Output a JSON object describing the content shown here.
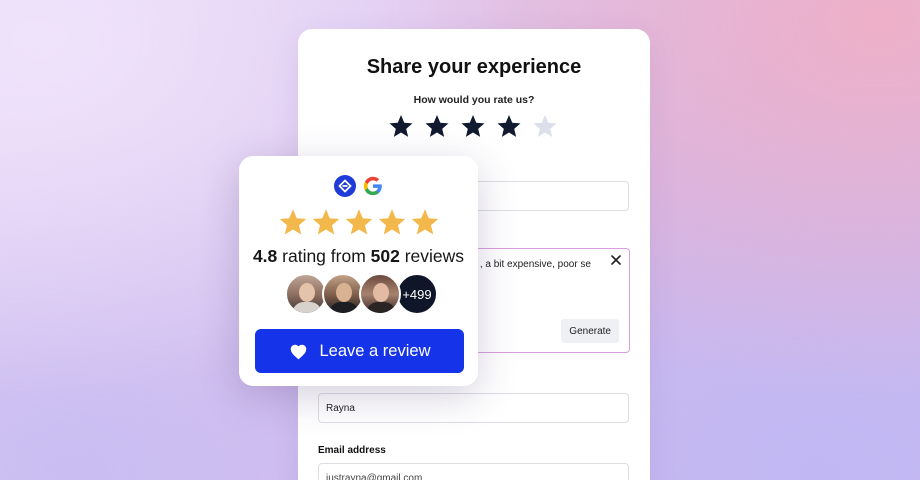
{
  "form": {
    "title": "Share your experience",
    "rate_question": "How would you rate us?",
    "rating": 4,
    "max_rating": 5,
    "star_color": "#121a30",
    "star_empty_color": "#dde0ea",
    "review_text": ", a bit expensive, poor se",
    "generate_label": "Generate",
    "name_value": "Rayna",
    "email_label": "Email address",
    "email_value": "justrayna@gmail.com"
  },
  "widget": {
    "brand_icon": "brand-logo-icon",
    "google_icon": "google-logo-icon",
    "stars": 4.8,
    "star_color": "#f2b84b",
    "rating_value": "4.8",
    "rating_mid": " rating from ",
    "review_count": "502",
    "rating_suffix": " reviews",
    "more_avatars": "+499",
    "button_label": "Leave a review",
    "button_icon": "heart-icon",
    "button_color": "#1533e8"
  }
}
